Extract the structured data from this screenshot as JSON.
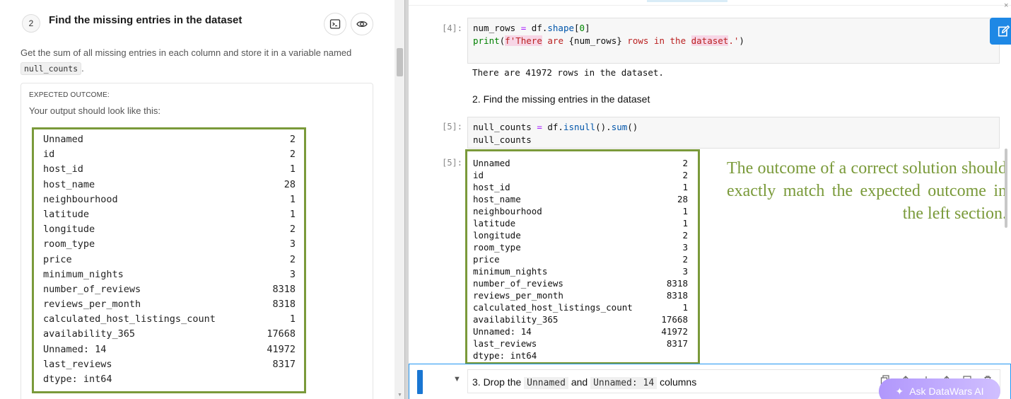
{
  "task": {
    "step_number": "2",
    "title": "Find the missing entries in the dataset",
    "description_prefix": "Get the sum of all missing entries in each column and store it in a variable named",
    "variable_name": "null_counts",
    "description_suffix": ".",
    "expected_label": "EXPECTED OUTCOME:",
    "expected_sub": "Your output should look like this:"
  },
  "expected_output": [
    {
      "name": "Unnamed",
      "value": "2"
    },
    {
      "name": "id",
      "value": "2"
    },
    {
      "name": "host_id",
      "value": "1"
    },
    {
      "name": "host_name",
      "value": "28"
    },
    {
      "name": "neighbourhood",
      "value": "1"
    },
    {
      "name": "latitude",
      "value": "1"
    },
    {
      "name": "longitude",
      "value": "2"
    },
    {
      "name": "room_type",
      "value": "3"
    },
    {
      "name": "price",
      "value": "2"
    },
    {
      "name": "minimum_nights",
      "value": "3"
    },
    {
      "name": "number_of_reviews",
      "value": "8318"
    },
    {
      "name": "reviews_per_month",
      "value": "8318"
    },
    {
      "name": "calculated_host_listings_count",
      "value": "1"
    },
    {
      "name": "availability_365",
      "value": "17668"
    },
    {
      "name": "Unnamed: 14",
      "value": "41972"
    },
    {
      "name": "last_reviews",
      "value": "8317"
    },
    {
      "name": "dtype: int64",
      "value": ""
    }
  ],
  "notebook": {
    "cell4": {
      "prompt": "[4]:",
      "line1_var": "num_rows",
      "line1_eq": " = ",
      "line1_rest": "df.",
      "line1_attr": "shape",
      "line1_idx_open": "[",
      "line1_idx": "0",
      "line1_idx_close": "]",
      "line2_func": "print",
      "line2_open": "(",
      "line2_str_a": "f'",
      "line2_str_b": "There",
      "line2_str_c": " are ",
      "line2_brace": "{num_rows}",
      "line2_str_d": " rows in the ",
      "line2_str_e": "dataset",
      "line2_str_f": ".'",
      "line2_close": ")",
      "stdout": "There are 41972 rows in the dataset."
    },
    "md_heading": "2. Find the missing entries in the dataset",
    "cell5": {
      "prompt": "[5]:",
      "line1_var": "null_counts",
      "line1_eq": " = ",
      "line1_df": "df.",
      "line1_m1": "isnull",
      "line1_p1": "().",
      "line1_m2": "sum",
      "line1_p2": "()",
      "line2": "null_counts",
      "out_prompt": "[5]:"
    },
    "annotation": "The outcome of a correct solution should exactly match the expected outcome in the left section.",
    "next_cell": {
      "prefix": "3. Drop the",
      "code1": "Unnamed",
      "middle": "and",
      "code2": "Unnamed: 14",
      "suffix": "columns"
    },
    "ask_button": "Ask DataWars AI"
  },
  "colors": {
    "annotation_green": "#7a9a3a",
    "accent_blue": "#1e88e5",
    "ask_purple": "#b197fc"
  }
}
